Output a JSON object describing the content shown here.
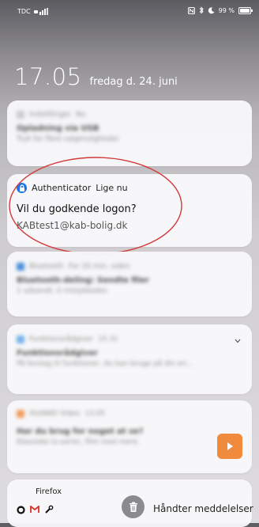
{
  "status_bar": {
    "carrier": "TDC",
    "signal_icon": "signal-icon",
    "battery_percent": "99 %",
    "battery_level": 0.99
  },
  "lockscreen": {
    "time": "17.05",
    "date": "fredag d. 24. juni"
  },
  "notifications": {
    "blurred_1": {
      "app": "Indstillinger",
      "time": "Nu",
      "title": "Opladning via USB",
      "text": "Tryk for flere valgmuligheder"
    },
    "authenticator": {
      "app": "Authenticator",
      "time": "Lige nu",
      "title": "Vil du godkende logon?",
      "body": "KABtest1@kab-bolig.dk"
    },
    "blurred_2": {
      "app": "Bluetooth",
      "time": "For 20 min. siden",
      "title": "Bluetooth-deling: Sendte filer",
      "text": "1 udsendt, 0 mislykkedes"
    },
    "blurred_3": {
      "app": "Funktionsrådgiver",
      "time": "15.31",
      "title": "Funktionsrådgiver",
      "text": "På forslag til funktioner, du kan bruge på din en..."
    },
    "blurred_4": {
      "app": "HUAWEI Video",
      "time": "13.05",
      "title": "Har du brug for noget at se?",
      "text": "Klassiske tv-serier, film med mere."
    },
    "firefox": {
      "app": "Firefox"
    }
  },
  "bottom": {
    "manage_label": "Håndter meddelelser"
  },
  "colors": {
    "annotation_red": "#d33a3a",
    "authenticator_blue": "#1a73e8",
    "video_orange": "#f08a3c"
  }
}
